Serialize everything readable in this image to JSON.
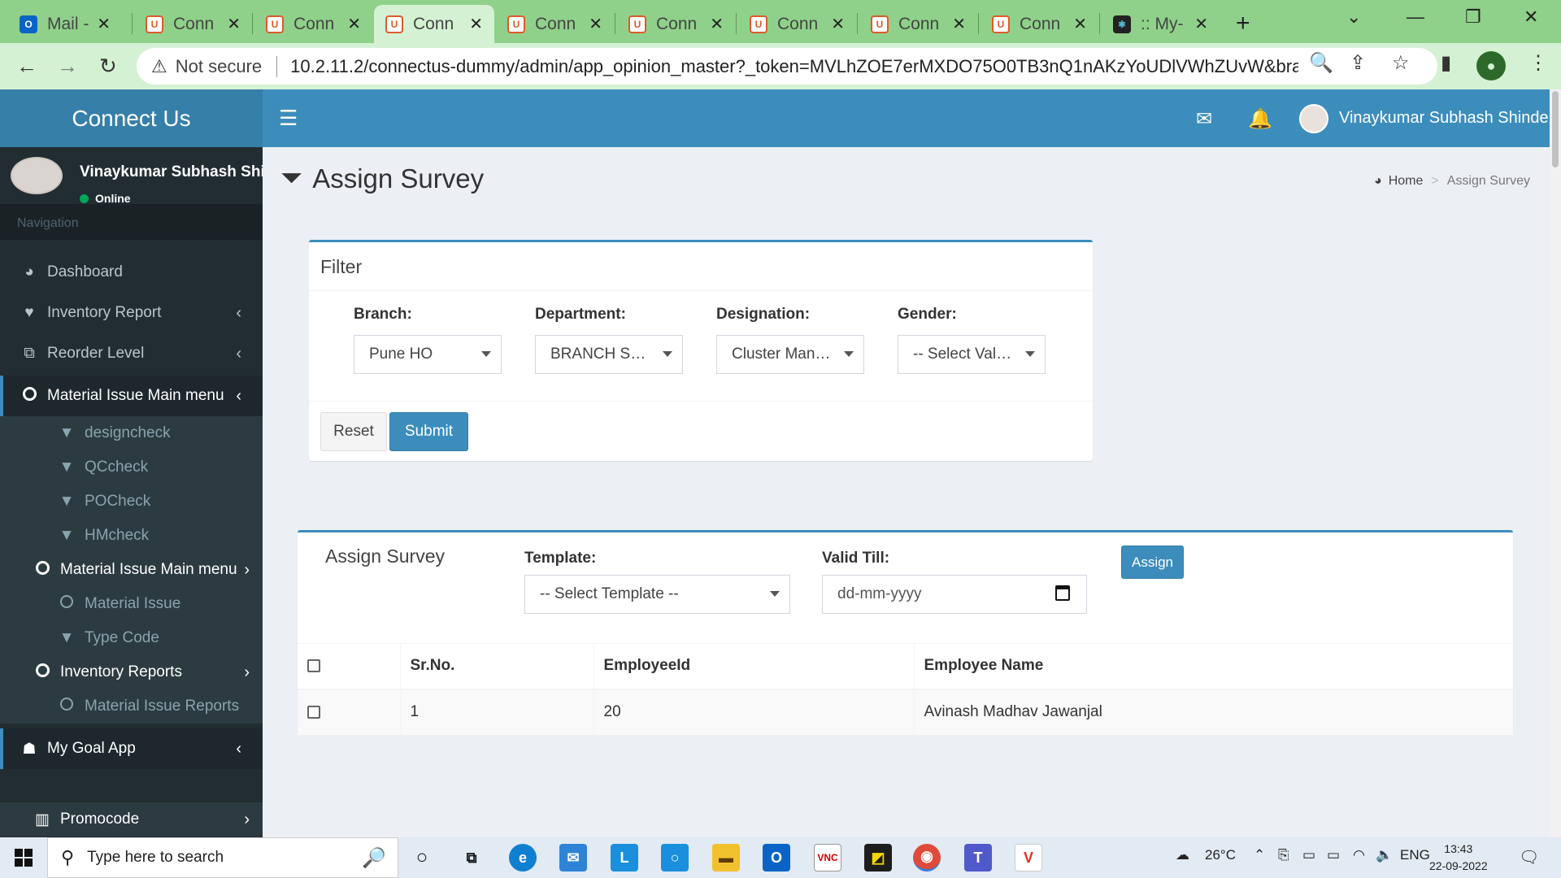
{
  "browser": {
    "tabs": [
      {
        "title": "Mail -",
        "icon": "outlook-icon"
      },
      {
        "title": "Conn",
        "icon": "connectus-icon"
      },
      {
        "title": "Conn",
        "icon": "connectus-icon"
      },
      {
        "title": "Conn",
        "icon": "connectus-icon",
        "active": true
      },
      {
        "title": "Conn",
        "icon": "connectus-icon"
      },
      {
        "title": "Conn",
        "icon": "connectus-icon"
      },
      {
        "title": "Conn",
        "icon": "connectus-icon"
      },
      {
        "title": "Conn",
        "icon": "connectus-icon"
      },
      {
        "title": "Conn",
        "icon": "connectus-icon"
      },
      {
        "title": ":: My-",
        "icon": "react-icon"
      }
    ],
    "security_label": "Not secure",
    "url": "10.2.11.2/connectus-dummy/admin/app_opinion_master?_token=MVLhZOE7erMXDO75O0TB3nQ1nAKzYoUDlVWhZUvW&bra...",
    "tab_color": "#8fd18a"
  },
  "app": {
    "logo": "Connect Us",
    "header_user": "Vinaykumar Subhash Shinde",
    "brand_color": "#3c8dbc"
  },
  "sidebar": {
    "user_name": "Vinaykumar Subhash Shinde",
    "status": "Online",
    "nav_header": "Navigation",
    "items": [
      {
        "label": "Dashboard",
        "icon": "dashboard-icon"
      },
      {
        "label": "Inventory Report",
        "icon": "heart-icon"
      },
      {
        "label": "Reorder Level",
        "icon": "sitemap-icon"
      },
      {
        "label": "Material Issue Main menu",
        "icon": "circle-icon"
      },
      {
        "label": "designcheck",
        "icon": "filter-icon"
      },
      {
        "label": "QCcheck",
        "icon": "filter-icon"
      },
      {
        "label": "POCheck",
        "icon": "filter-icon"
      },
      {
        "label": "HMcheck",
        "icon": "filter-icon"
      },
      {
        "label": "Material Issue Main menu",
        "icon": "circle-icon"
      },
      {
        "label": "Material Issue",
        "icon": "circle-icon"
      },
      {
        "label": "Type Code",
        "icon": "filter-icon"
      },
      {
        "label": "Inventory Reports",
        "icon": "circle-icon"
      },
      {
        "label": "Material Issue Reports",
        "icon": "circle-icon"
      },
      {
        "label": "My Goal App",
        "icon": "android-icon"
      },
      {
        "label": "Promocode",
        "icon": "barcode-icon"
      }
    ]
  },
  "page": {
    "title": "Assign Survey",
    "breadcrumb_home": "Home",
    "breadcrumb_current": "Assign Survey"
  },
  "filter": {
    "title": "Filter",
    "branch_label": "Branch:",
    "branch_value": "Pune HO",
    "department_label": "Department:",
    "department_value": "BRANCH SAL...",
    "designation_label": "Designation:",
    "designation_value": "Cluster Mana...",
    "gender_label": "Gender:",
    "gender_value": "-- Select Value --",
    "reset_label": "Reset",
    "submit_label": "Submit"
  },
  "assign": {
    "title": "Assign Survey",
    "template_label": "Template:",
    "template_value": "-- Select Template --",
    "valid_till_label": "Valid Till:",
    "valid_till_placeholder": "dd-mm-yyyy",
    "assign_label": "Assign",
    "columns": [
      "Sr.No.",
      "EmployeeId",
      "Employee Name"
    ],
    "rows": [
      {
        "sr_no": "1",
        "employee_id": "20",
        "employee_name": "Avinash Madhav Jawanjal"
      }
    ]
  },
  "taskbar": {
    "search_placeholder": "Type here to search",
    "temperature": "26°C",
    "language": "ENG",
    "time": "13:43",
    "date": "22-09-2022"
  }
}
